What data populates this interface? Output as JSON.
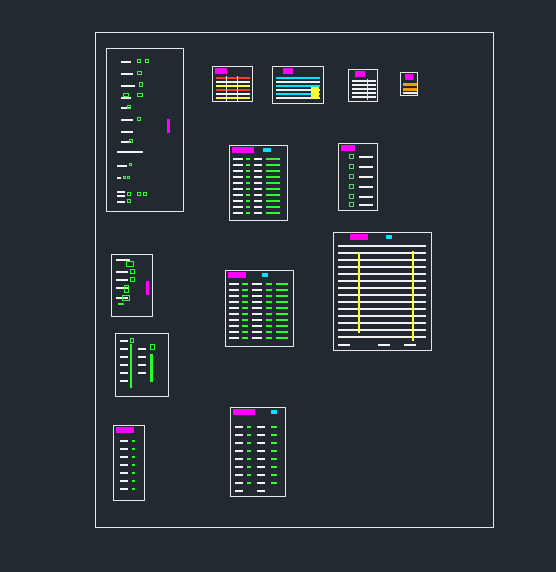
{
  "viewport": {
    "background": "#222930"
  },
  "sheets": [
    {
      "id": "legend-main",
      "title": ""
    },
    {
      "id": "table-a",
      "title": ""
    },
    {
      "id": "table-b",
      "title": ""
    },
    {
      "id": "table-c",
      "title": ""
    },
    {
      "id": "table-d",
      "title": ""
    },
    {
      "id": "schedule-1",
      "title": ""
    },
    {
      "id": "schedule-2",
      "title": ""
    },
    {
      "id": "schedule-3",
      "title": ""
    },
    {
      "id": "schedule-4",
      "title": ""
    },
    {
      "id": "symbols-1",
      "title": ""
    },
    {
      "id": "symbols-2",
      "title": ""
    },
    {
      "id": "notes-1",
      "title": ""
    },
    {
      "id": "notes-2",
      "title": ""
    }
  ],
  "colors": {
    "frame": "#e6e6e6",
    "title": "#ff00ff",
    "subtitle": "#00e5ff",
    "text": "#f2f2f2",
    "symbol": "#2bff2b",
    "highlight": "#ffff33",
    "accent_red": "#ff3b30",
    "accent_orange": "#ff9900"
  }
}
